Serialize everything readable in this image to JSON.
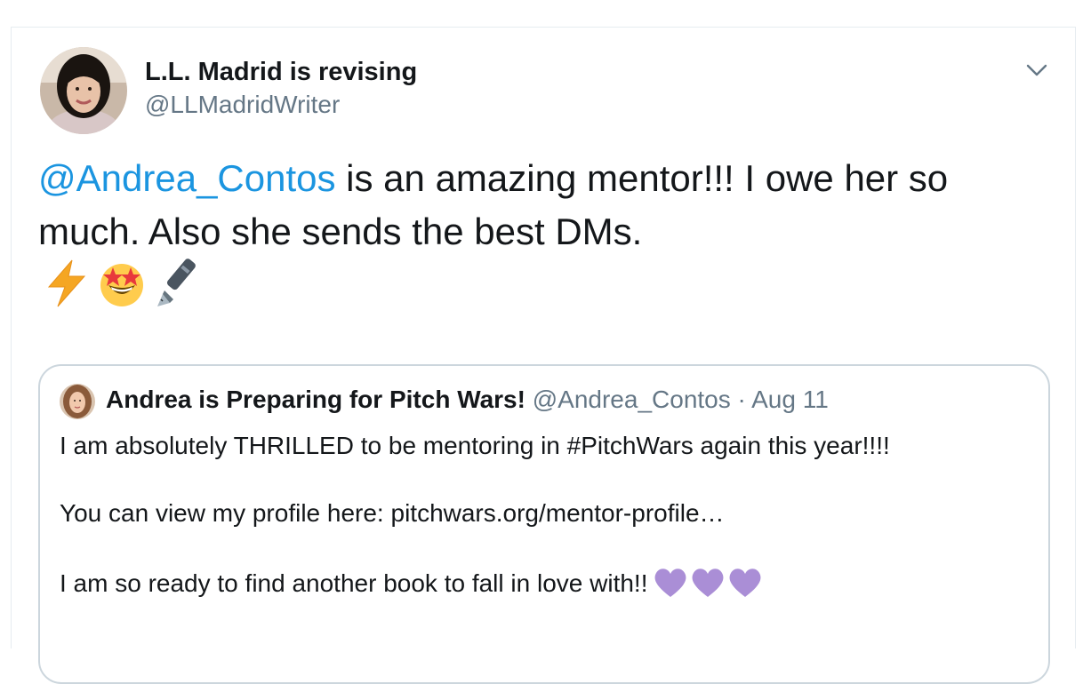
{
  "tweet": {
    "author": {
      "display_name": "L.L. Madrid is revising",
      "handle": "@LLMadridWriter"
    },
    "text": {
      "mention": "@Andrea_Contos",
      "line1_rest": " is an amazing mentor!!! I owe her so",
      "line2": "much. Also she sends the best DMs."
    },
    "emojis": [
      "lightning-emoji",
      "star-struck-emoji",
      "fountain-pen-emoji"
    ],
    "menu_icon": "chevron-down-icon"
  },
  "quoted_tweet": {
    "author": {
      "display_name": "Andrea is Preparing for Pitch Wars!",
      "handle": "@Andrea_Contos",
      "separator": "·",
      "date": "Aug 11"
    },
    "lines": [
      "I am absolutely THRILLED to be mentoring in #PitchWars again this year!!!!",
      "You can view my profile here: pitchwars.org/mentor-profile…",
      "I am so ready to find another book to fall in love with!!"
    ],
    "hearts": [
      "purple-heart-emoji",
      "purple-heart-emoji",
      "purple-heart-emoji"
    ]
  },
  "colors": {
    "link": "#1b95e0",
    "secondary_text": "#657786",
    "border": "#ccd6dd",
    "heart": "#aa8ed6"
  }
}
